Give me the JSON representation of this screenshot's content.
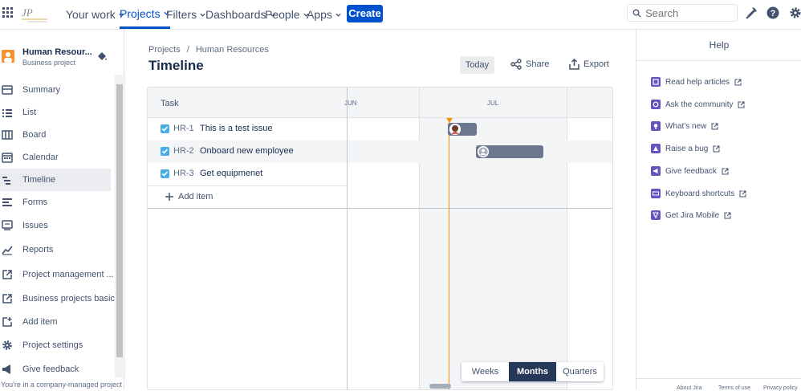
{
  "topnav": {
    "items": [
      {
        "label": "Your work"
      },
      {
        "label": "Projects"
      },
      {
        "label": "Filters"
      },
      {
        "label": "Dashboards"
      },
      {
        "label": "People"
      },
      {
        "label": "Apps"
      }
    ],
    "create_label": "Create",
    "search_placeholder": "Search"
  },
  "project": {
    "name": "Human Resour...",
    "type": "Business project"
  },
  "sidebar": {
    "items": [
      {
        "label": "Summary",
        "icon": "summary-icon"
      },
      {
        "label": "List",
        "icon": "list-icon"
      },
      {
        "label": "Board",
        "icon": "board-icon"
      },
      {
        "label": "Calendar",
        "icon": "calendar-icon"
      },
      {
        "label": "Timeline",
        "icon": "timeline-icon",
        "active": true
      },
      {
        "label": "Forms",
        "icon": "forms-icon"
      },
      {
        "label": "Issues",
        "icon": "issues-icon"
      },
      {
        "label": "Reports",
        "icon": "reports-icon"
      },
      {
        "label": "Project management ...",
        "icon": "shortcut-icon"
      },
      {
        "label": "Business projects basics",
        "icon": "shortcut-icon"
      },
      {
        "label": "Add item",
        "icon": "add-shortcut-icon"
      },
      {
        "label": "Project settings",
        "icon": "gear-icon"
      },
      {
        "label": "Give feedback",
        "icon": "megaphone-icon"
      }
    ],
    "footer": "You're in a company-managed project"
  },
  "main": {
    "breadcrumb": {
      "parent": "Projects",
      "separator": "/",
      "current": "Human Resources"
    },
    "title": "Timeline",
    "today_label": "Today",
    "share_label": "Share",
    "export_label": "Export"
  },
  "timeline": {
    "task_header": "Task",
    "months": [
      "JUN",
      "JUL"
    ],
    "rows": [
      {
        "key": "HR-1",
        "summary": "This is a test issue",
        "done": true
      },
      {
        "key": "HR-2",
        "summary": "Onboard new employee",
        "done": true
      },
      {
        "key": "HR-3",
        "summary": "Get equipmenet",
        "done": true
      }
    ],
    "add_item_label": "Add item",
    "views": [
      {
        "label": "Weeks",
        "active": false
      },
      {
        "label": "Months",
        "active": true
      },
      {
        "label": "Quarters",
        "active": false
      }
    ]
  },
  "help": {
    "title": "Help",
    "links": [
      {
        "label": "Read help articles",
        "icon": "book-icon"
      },
      {
        "label": "Ask the community",
        "icon": "chat-icon"
      },
      {
        "label": "What's new",
        "icon": "lightbulb-icon"
      },
      {
        "label": "Raise a bug",
        "icon": "warning-icon"
      },
      {
        "label": "Give feedback",
        "icon": "megaphone-icon"
      },
      {
        "label": "Keyboard shortcuts",
        "icon": "keyboard-icon"
      },
      {
        "label": "Get Jira Mobile",
        "icon": "mobile-icon"
      }
    ],
    "footer": [
      "About Jira",
      "Terms of use",
      "Privacy policy"
    ]
  },
  "colors": {
    "brand": "#0052cc",
    "today_line": "#ff8b00",
    "bar": "#6b778c",
    "help_icon": "#6554c0"
  }
}
